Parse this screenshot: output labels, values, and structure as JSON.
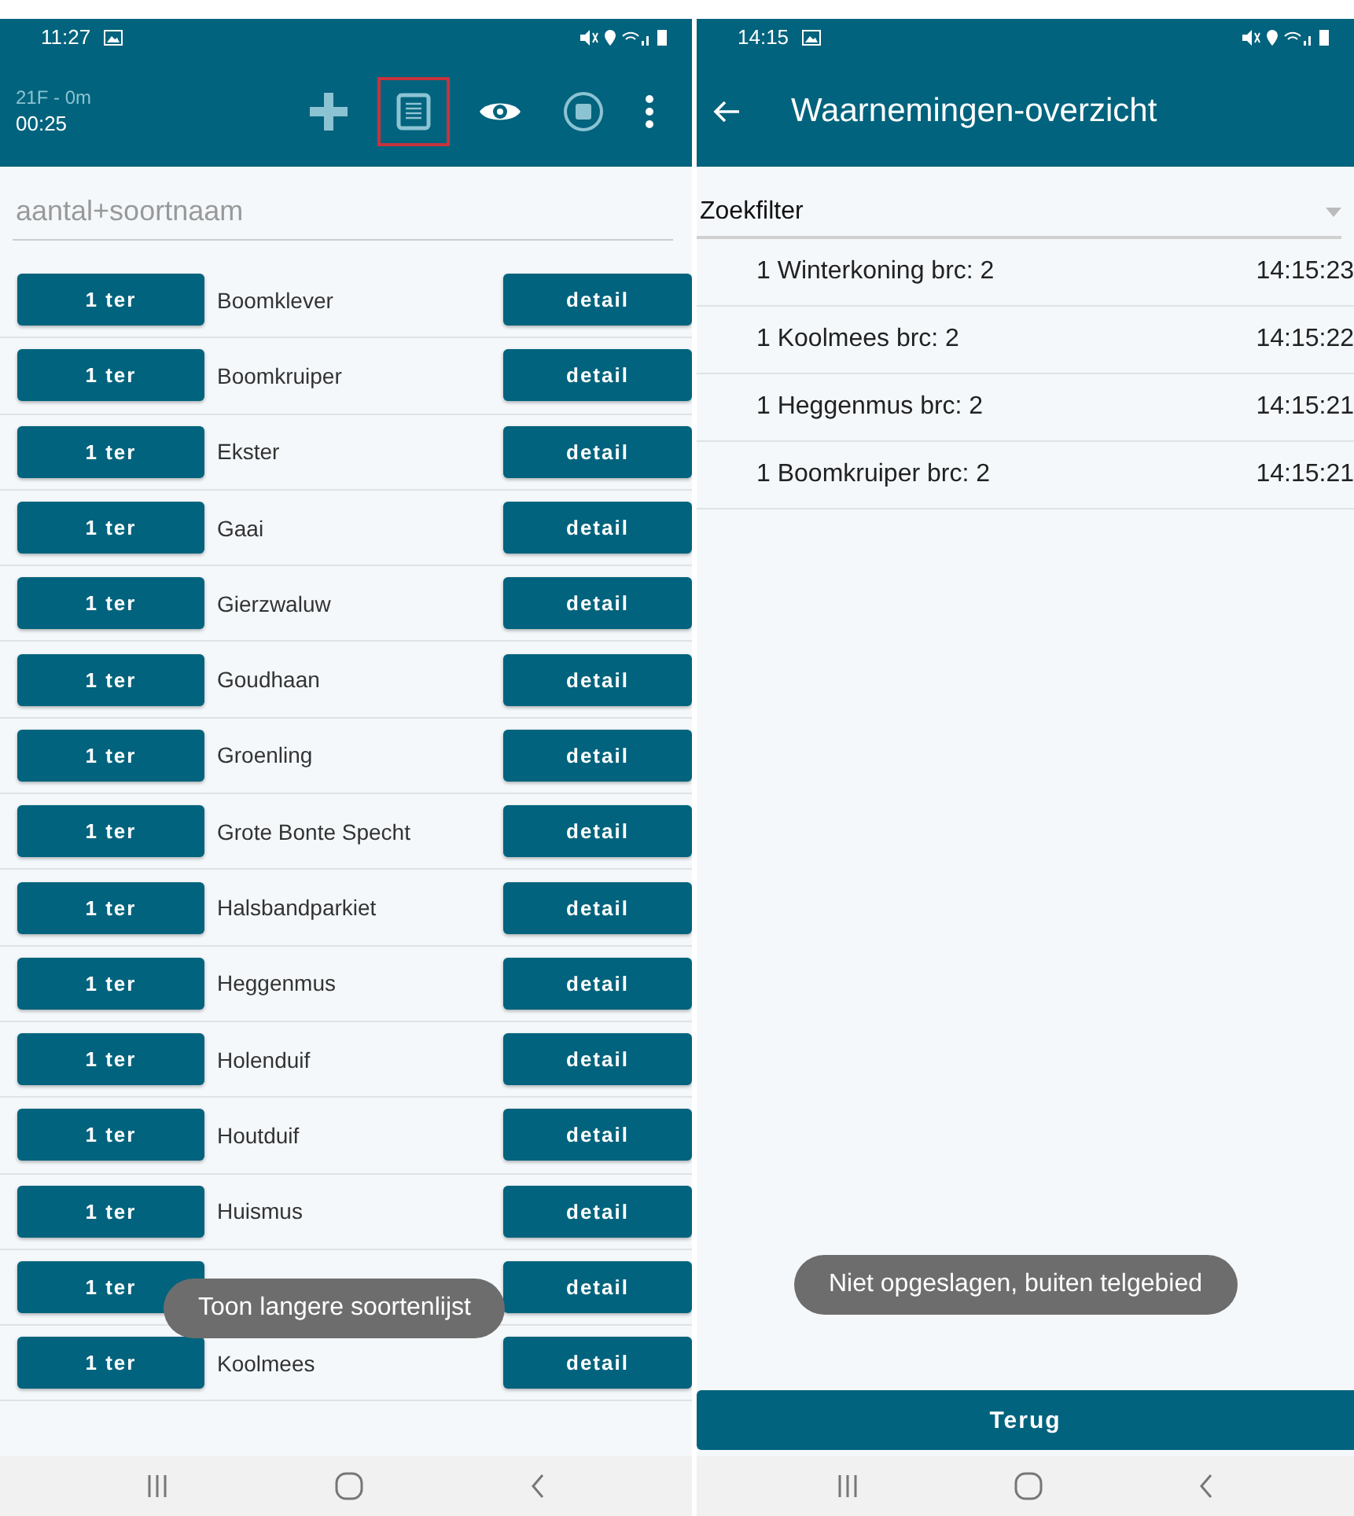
{
  "left": {
    "status_bar": {
      "time": "11:27"
    },
    "toolbar": {
      "title": "21F - 0m",
      "timer": "00:25",
      "actions": [
        {
          "kind": "plus",
          "highlighted": false
        },
        {
          "kind": "list",
          "highlighted": true
        },
        {
          "kind": "eye",
          "highlighted": false
        },
        {
          "kind": "stop",
          "highlighted": false
        },
        {
          "kind": "more",
          "highlighted": false
        }
      ]
    },
    "search": {
      "placeholder": "aantal+soortnaam"
    },
    "species": [
      {
        "count_button": "1 ter",
        "name": "Boomklever",
        "detail_button": "detail"
      },
      {
        "count_button": "1 ter",
        "name": "Boomkruiper",
        "detail_button": "detail"
      },
      {
        "count_button": "1 ter",
        "name": "Ekster",
        "detail_button": "detail"
      },
      {
        "count_button": "1 ter",
        "name": "Gaai",
        "detail_button": "detail"
      },
      {
        "count_button": "1 ter",
        "name": "Gierzwaluw",
        "detail_button": "detail"
      },
      {
        "count_button": "1 ter",
        "name": "Goudhaan",
        "detail_button": "detail"
      },
      {
        "count_button": "1 ter",
        "name": "Groenling",
        "detail_button": "detail"
      },
      {
        "count_button": "1 ter",
        "name": "Grote Bonte Specht",
        "detail_button": "detail"
      },
      {
        "count_button": "1 ter",
        "name": "Halsbandparkiet",
        "detail_button": "detail"
      },
      {
        "count_button": "1 ter",
        "name": "Heggenmus",
        "detail_button": "detail"
      },
      {
        "count_button": "1 ter",
        "name": "Holenduif",
        "detail_button": "detail"
      },
      {
        "count_button": "1 ter",
        "name": "Houtduif",
        "detail_button": "detail"
      },
      {
        "count_button": "1 ter",
        "name": "Huismus",
        "detail_button": "detail"
      },
      {
        "count_button": "1 ter",
        "detail_button": "detail"
      },
      {
        "count_button": "1 ter",
        "name": "Koolmees",
        "detail_button": "detail"
      }
    ],
    "toast": "Toon langere soortenlijst"
  },
  "right": {
    "status_bar": {
      "time": "14:15"
    },
    "toolbar": {
      "title": "Waarnemingen-overzicht"
    },
    "filter": {
      "value": "Zoekfilter"
    },
    "observations": [
      {
        "text": "1 Winterkoning brc: 2",
        "time": "14:15:23"
      },
      {
        "text": "1 Koolmees brc: 2",
        "time": "14:15:22"
      },
      {
        "text": "1 Heggenmus brc: 2",
        "time": "14:15:21"
      },
      {
        "text": "1 Boomkruiper brc: 2",
        "time": "14:15:21"
      }
    ],
    "toast": "Niet opgeslagen, buiten telgebied",
    "back_button": "Terug"
  }
}
